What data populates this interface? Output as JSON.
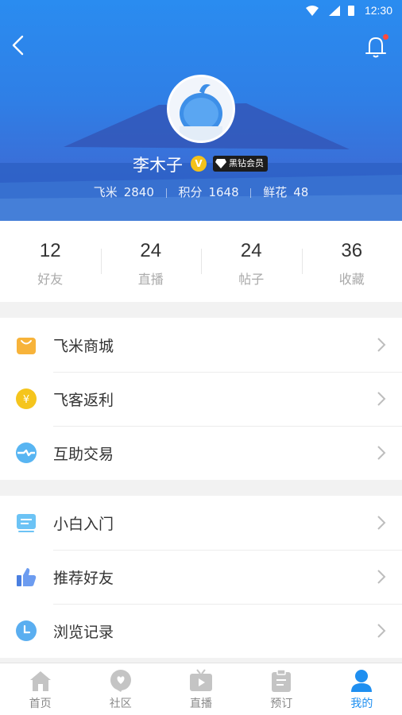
{
  "status_bar": {
    "time": "12:30"
  },
  "profile": {
    "name": "李木子",
    "verified_badge": "V",
    "membership_badge": "黑钻会员",
    "stats": [
      {
        "label": "飞米",
        "value": "2840"
      },
      {
        "label": "积分",
        "value": "1648"
      },
      {
        "label": "鲜花",
        "value": "48"
      }
    ]
  },
  "counts": [
    {
      "value": "12",
      "label": "好友"
    },
    {
      "value": "24",
      "label": "直播"
    },
    {
      "value": "24",
      "label": "帖子"
    },
    {
      "value": "36",
      "label": "收藏"
    }
  ],
  "menu_group_1": [
    {
      "label": "飞米商城",
      "icon": "shopping-bag-icon"
    },
    {
      "label": "飞客返利",
      "icon": "yen-coin-icon"
    },
    {
      "label": "互助交易",
      "icon": "exchange-icon"
    }
  ],
  "menu_group_2": [
    {
      "label": "小白入门",
      "icon": "guide-screen-icon"
    },
    {
      "label": "推荐好友",
      "icon": "thumbs-up-icon"
    },
    {
      "label": "浏览记录",
      "icon": "clock-icon"
    }
  ],
  "tabbar": [
    {
      "label": "首页",
      "icon": "home-icon"
    },
    {
      "label": "社区",
      "icon": "community-icon"
    },
    {
      "label": "直播",
      "icon": "live-tv-icon"
    },
    {
      "label": "预订",
      "icon": "clipboard-icon"
    },
    {
      "label": "我的",
      "icon": "user-icon",
      "active": true
    }
  ],
  "colors": {
    "header_blue": "#2a8cf0",
    "active_tab": "#1f8ff0",
    "notification_dot": "#ff4a3d",
    "verified_gold": "#f4c21a"
  }
}
